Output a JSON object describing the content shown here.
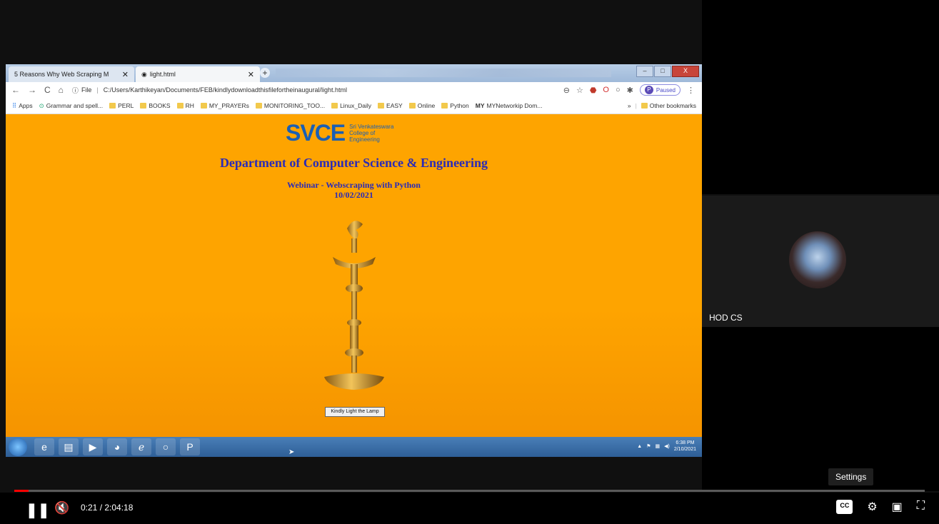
{
  "browser": {
    "tab1_title": "5 Reasons Why Web Scraping M",
    "tab2_title": "light.html",
    "url_prefix": "File",
    "url": "C:/Users/Karthikeyan/Documents/FEB/kindlydownloadthisfilefortheinaugural/light.html",
    "profile_initial": "P",
    "profile_status": "Paused",
    "bookmarks": [
      {
        "label": "Apps"
      },
      {
        "label": "Grammar and spell..."
      },
      {
        "label": "PERL"
      },
      {
        "label": "BOOKS"
      },
      {
        "label": "RH"
      },
      {
        "label": "MY_PRAYERs"
      },
      {
        "label": "MONITORING_TOO..."
      },
      {
        "label": "Linux_Daily"
      },
      {
        "label": "EASY"
      },
      {
        "label": "Online"
      },
      {
        "label": "Python"
      },
      {
        "label": "MYNetworkip Dom..."
      }
    ],
    "bookmarks_more": "»",
    "other_bookmarks": "Other bookmarks"
  },
  "page": {
    "logo_text": "SVCE",
    "logo_line1": "Sri Venkateswara",
    "logo_line2": "College of",
    "logo_line3": "Engineering",
    "department": "Department of Computer Science & Engineering",
    "webinar": "Webinar - Webscraping with Python",
    "date": "10/02/2021",
    "lamp_button": "Kindly Light the Lamp"
  },
  "taskbar": {
    "time": "6:38 PM",
    "date": "2/10/2021"
  },
  "participant": {
    "name": "HOD CS"
  },
  "player": {
    "tooltip": "Settings",
    "time_display": "0:21 / 2:04:18",
    "progress_fraction": 0.0028,
    "cc_label": "CC"
  }
}
